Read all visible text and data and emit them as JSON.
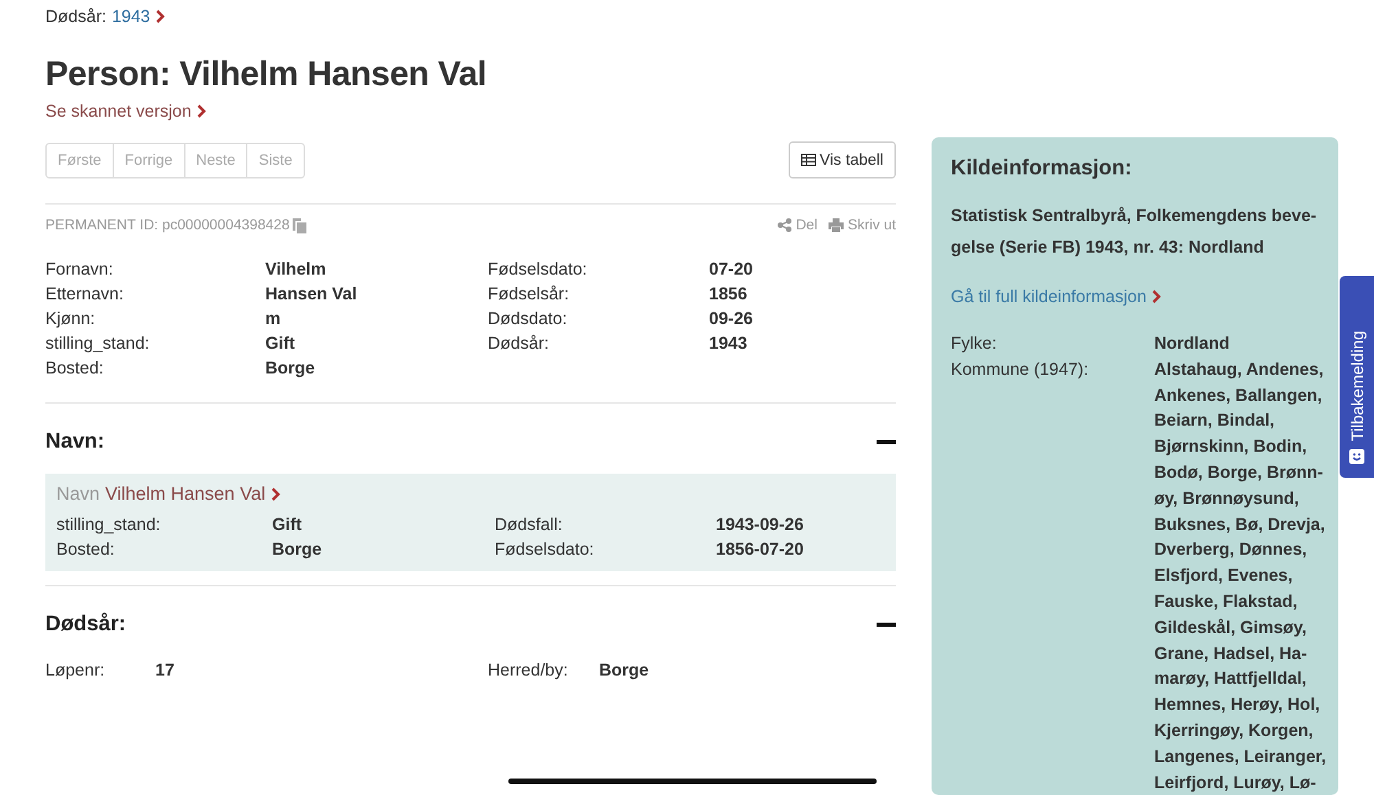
{
  "breadcrumb": {
    "label": "Dødsår:",
    "value": "1943"
  },
  "title": "Person: Vilhelm Hansen Val",
  "scan_link": "Se skannet versjon",
  "pager": [
    {
      "label": "Første",
      "disabled": true
    },
    {
      "label": "Forrige",
      "disabled": true
    },
    {
      "label": "Neste",
      "disabled": true
    },
    {
      "label": "Siste",
      "disabled": true
    }
  ],
  "table_button": "Vis tabell",
  "permanent_id": "PERMANENT ID: pc00000004398428",
  "actions": [
    {
      "kind": "share",
      "label": "Del"
    },
    {
      "kind": "print",
      "label": "Skriv ut"
    }
  ],
  "person_fields": [
    [
      {
        "label": "Fornavn:",
        "value": "Vilhelm"
      },
      {
        "label": "Fødselsdato:",
        "value": "07-20"
      }
    ],
    [
      {
        "label": "Etternavn:",
        "value": "Hansen Val"
      },
      {
        "label": "Fødselsår:",
        "value": "1856"
      }
    ],
    [
      {
        "label": "Kjønn:",
        "value": "m"
      },
      {
        "label": "Dødsdato:",
        "value": "09-26"
      }
    ],
    [
      {
        "label": "stilling_stand:",
        "value": "Gift"
      },
      {
        "label": "Dødsår:",
        "value": "1943"
      }
    ],
    [
      {
        "label": "Bosted:",
        "value": "Borge"
      }
    ]
  ],
  "sections": [
    {
      "title": "Navn:",
      "expanded": true,
      "card": {
        "prefix": "Navn",
        "link": "Vilhelm Hansen Val",
        "rows": [
          [
            {
              "label": "stilling_stand:",
              "value": "Gift"
            },
            {
              "label": "Dødsfall:",
              "value": "1943-09-26"
            }
          ],
          [
            {
              "label": "Bosted:",
              "value": "Borge"
            },
            {
              "label": "Fødselsdato:",
              "value": "1856-07-20"
            }
          ]
        ]
      }
    },
    {
      "title": "Dødsår:",
      "expanded": true,
      "rows": [
        [
          {
            "label": "Løpenr:",
            "value": "17"
          },
          {
            "label": "Herred/by:",
            "value": "Borge"
          }
        ]
      ]
    }
  ],
  "source": {
    "title": "Kildeinformasjon:",
    "text_lines": [
      "Statistisk Sentralbyrå, Folkemengdens beve-",
      "gelse (Serie FB) 1943, nr. 43: Nordland"
    ],
    "link": "Gå til full kildeinformasjon",
    "fields": [
      {
        "label": "Fylke:",
        "lines": [
          "Nordland"
        ]
      },
      {
        "label": "Kommune (1947):",
        "lines": [
          "Alstahaug, Andenes,",
          "Ankenes, Ballangen,",
          "Beiarn, Bindal,",
          "Bjørnskinn, Bodin,",
          "Bodø, Borge, Brønn-",
          "øy, Brønnøysund,",
          "Buksnes, Bø, Drevja,",
          "Dverberg, Dønnes,",
          "Elsfjord, Evenes,",
          "Fauske, Flakstad,",
          "Gildeskål, Gimsøy,",
          "Grane, Hadsel, Ha-",
          "marøy, Hattfjelldal,",
          "Hemnes, Herøy, Hol,",
          "Kjerringøy, Korgen,",
          "Langenes, Leiranger,",
          "Leirfjord, Lurøy, Lø-"
        ]
      }
    ]
  },
  "feedback_tab": "Tilbakemelding"
}
